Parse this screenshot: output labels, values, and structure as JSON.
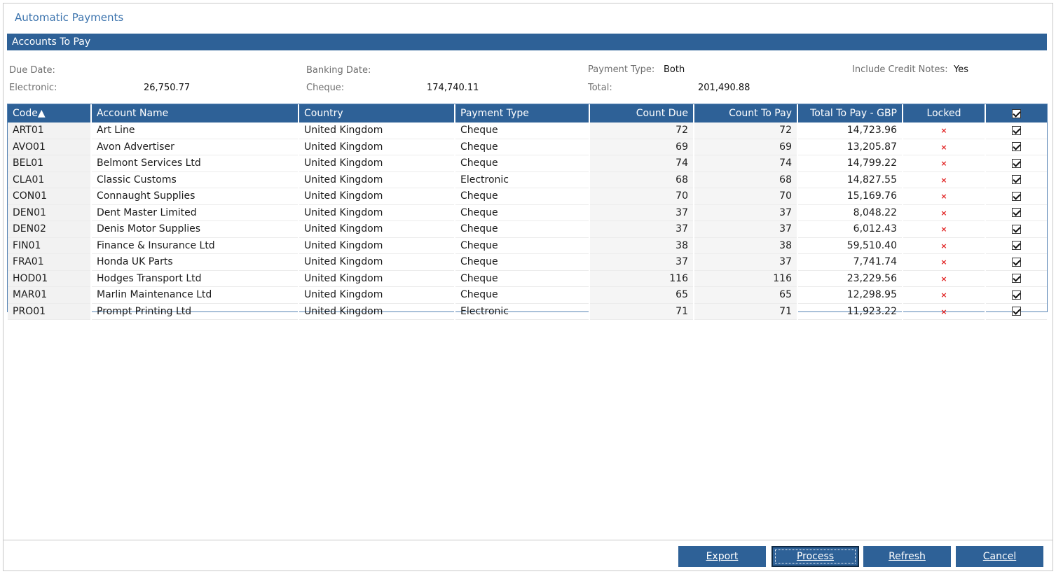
{
  "window": {
    "title": "Automatic Payments",
    "section_title": "Accounts To Pay"
  },
  "info": {
    "due_date_label": "Due Date:",
    "due_date_value": "",
    "banking_date_label": "Banking Date:",
    "banking_date_value": "",
    "payment_type_label": "Payment Type:",
    "payment_type_value": "Both",
    "include_credit_notes_label": "Include Credit Notes:",
    "include_credit_notes_value": "Yes",
    "electronic_label": "Electronic:",
    "electronic_value": "26,750.77",
    "cheque_label": "Cheque:",
    "cheque_value": "174,740.11",
    "total_label": "Total:",
    "total_value": "201,490.88"
  },
  "table": {
    "columns": [
      "Code",
      "Account Name",
      "Country",
      "Payment Type",
      "Count Due",
      "Count To Pay",
      "Total To Pay - GBP",
      "Locked"
    ],
    "sort_indicator": "▲",
    "rows": [
      {
        "code": "ART01",
        "name": "Art Line",
        "country": "United Kingdom",
        "payment_type": "Cheque",
        "count_due": "72",
        "count_to_pay": "72",
        "total": "14,723.96",
        "locked": "×"
      },
      {
        "code": "AVO01",
        "name": "Avon Advertiser",
        "country": "United Kingdom",
        "payment_type": "Cheque",
        "count_due": "69",
        "count_to_pay": "69",
        "total": "13,205.87",
        "locked": "×"
      },
      {
        "code": "BEL01",
        "name": "Belmont Services Ltd",
        "country": "United Kingdom",
        "payment_type": "Cheque",
        "count_due": "74",
        "count_to_pay": "74",
        "total": "14,799.22",
        "locked": "×"
      },
      {
        "code": "CLA01",
        "name": "Classic Customs",
        "country": "United Kingdom",
        "payment_type": "Electronic",
        "count_due": "68",
        "count_to_pay": "68",
        "total": "14,827.55",
        "locked": "×"
      },
      {
        "code": "CON01",
        "name": "Connaught Supplies",
        "country": "United Kingdom",
        "payment_type": "Cheque",
        "count_due": "70",
        "count_to_pay": "70",
        "total": "15,169.76",
        "locked": "×"
      },
      {
        "code": "DEN01",
        "name": "Dent Master Limited",
        "country": "United Kingdom",
        "payment_type": "Cheque",
        "count_due": "37",
        "count_to_pay": "37",
        "total": "8,048.22",
        "locked": "×"
      },
      {
        "code": "DEN02",
        "name": "Denis Motor Supplies",
        "country": "United Kingdom",
        "payment_type": "Cheque",
        "count_due": "37",
        "count_to_pay": "37",
        "total": "6,012.43",
        "locked": "×"
      },
      {
        "code": "FIN01",
        "name": "Finance & Insurance Ltd",
        "country": "United Kingdom",
        "payment_type": "Cheque",
        "count_due": "38",
        "count_to_pay": "38",
        "total": "59,510.40",
        "locked": "×"
      },
      {
        "code": "FRA01",
        "name": "Honda UK Parts",
        "country": "United Kingdom",
        "payment_type": "Cheque",
        "count_due": "37",
        "count_to_pay": "37",
        "total": "7,741.74",
        "locked": "×"
      },
      {
        "code": "HOD01",
        "name": "Hodges Transport Ltd",
        "country": "United Kingdom",
        "payment_type": "Cheque",
        "count_due": "116",
        "count_to_pay": "116",
        "total": "23,229.56",
        "locked": "×"
      },
      {
        "code": "MAR01",
        "name": "Marlin Maintenance Ltd",
        "country": "United Kingdom",
        "payment_type": "Cheque",
        "count_due": "65",
        "count_to_pay": "65",
        "total": "12,298.95",
        "locked": "×"
      },
      {
        "code": "PRO01",
        "name": "Prompt Printing Ltd",
        "country": "United Kingdom",
        "payment_type": "Electronic",
        "count_due": "71",
        "count_to_pay": "71",
        "total": "11,923.22",
        "locked": "×"
      }
    ]
  },
  "buttons": {
    "export": "Export",
    "process": "Process",
    "refresh": "Refresh",
    "cancel": "Cancel"
  },
  "colors": {
    "header_blue": "#2e6197",
    "title_blue": "#3b73ad",
    "locked_red": "#e02020"
  },
  "icons": {
    "locked": "cross-icon",
    "select": "checkbox-checked-icon",
    "sort": "sort-ascending-icon"
  }
}
